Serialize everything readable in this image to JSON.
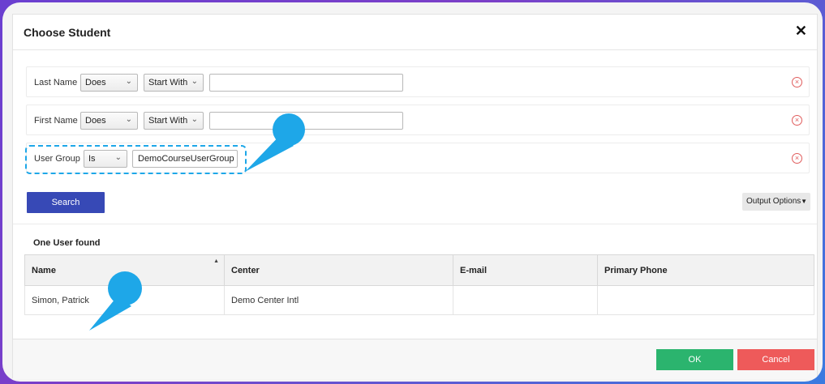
{
  "dialog": {
    "title": "Choose Student",
    "close_icon": "close-icon"
  },
  "filters": [
    {
      "label": "Last Name",
      "operator": "Does",
      "condition": "Start With",
      "value": ""
    },
    {
      "label": "First Name",
      "operator": "Does",
      "condition": "Start With",
      "value": ""
    },
    {
      "label": "User Group",
      "operator": "Is",
      "value": "DemoCourseUserGroup"
    }
  ],
  "actions": {
    "search_label": "Search",
    "output_options_label": "Output Options"
  },
  "results": {
    "count_text": "One User found",
    "columns": [
      "Name",
      "Center",
      "E-mail",
      "Primary Phone"
    ],
    "rows": [
      {
        "name": "Simon, Patrick",
        "center": "Demo Center Intl",
        "email": "",
        "phone": ""
      }
    ]
  },
  "footer": {
    "ok_label": "OK",
    "cancel_label": "Cancel"
  },
  "colors": {
    "search": "#3749b6",
    "ok": "#2bb46e",
    "cancel": "#ee5a5a",
    "callout": "#1ea7e8"
  }
}
